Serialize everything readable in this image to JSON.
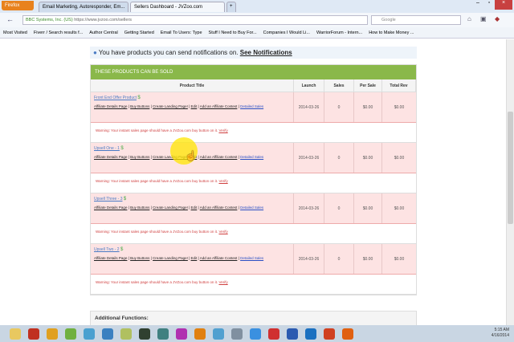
{
  "browser": {
    "menu": "Firefox",
    "tabs": [
      "Email Marketing, Autoresponder, Em...",
      "Sellers Dashboard - JVZoo.com"
    ],
    "identity": "BBC Systems, Inc. (US)",
    "url": "https://www.jvzoo.com/sellers",
    "search_placeholder": "Google",
    "bookmarks": [
      "Most Visited",
      "Fiverr / Search results f...",
      "Author Central",
      "Getting Started",
      "Email To Users: Type",
      "Stuff I Need to Buy For...",
      "Companies I Would Li...",
      "WarriorForum - Intern...",
      "How to Make Money ..."
    ]
  },
  "notice": {
    "text": "You have products you can send notifications on.",
    "link": "See Notifications"
  },
  "table": {
    "title": "THESE PRODUCTS CAN BE SOLD",
    "columns": [
      "Product Title",
      "Launch",
      "Sales",
      "Per Sale",
      "Total Rev"
    ],
    "actions": [
      "Affiliate Details Page",
      "Buy Buttons",
      "Create Landing Page!",
      "Edit",
      "Add an Affiliate Contest",
      "Detailed Sales"
    ],
    "warning": "Warning: Your instant sales page should have a JVZoo.com buy button on it.",
    "verify": "Verify",
    "rows": [
      {
        "title": "Front End Offer Product",
        "launch": "2014-03-26",
        "sales": "0",
        "per_sale": "$0.00",
        "total": "$0.00"
      },
      {
        "title": "Upsell One - 1",
        "launch": "2014-03-26",
        "sales": "0",
        "per_sale": "$0.00",
        "total": "$0.00"
      },
      {
        "title": "Upsell Three - 3",
        "launch": "2014-03-26",
        "sales": "0",
        "per_sale": "$0.00",
        "total": "$0.00"
      },
      {
        "title": "Upsell Two - 2",
        "launch": "2014-03-26",
        "sales": "0",
        "per_sale": "$0.00",
        "total": "$0.00"
      }
    ]
  },
  "additional": "Additional Functions:",
  "clock": {
    "time": "5:15 AM",
    "date": "4/16/2014"
  },
  "taskbar_icons": [
    [
      "explorer",
      "#e8c860"
    ],
    [
      "filezilla",
      "#c03020"
    ],
    [
      "chrome",
      "#e0a020"
    ],
    [
      "dragon",
      "#70b040"
    ],
    [
      "app1",
      "#4aa0d0"
    ],
    [
      "app2",
      "#3a80c0"
    ],
    [
      "notes",
      "#b0c060"
    ],
    [
      "app3",
      "#304030"
    ],
    [
      "app4",
      "#408080"
    ],
    [
      "picasa",
      "#b030b0"
    ],
    [
      "audacity",
      "#e08010"
    ],
    [
      "lync",
      "#50a0d0"
    ],
    [
      "app5",
      "#8090a0"
    ],
    [
      "ie",
      "#3a90e0"
    ],
    [
      "acrobat",
      "#d03030"
    ],
    [
      "word",
      "#2a5ab0"
    ],
    [
      "outlook",
      "#1a70c0"
    ],
    [
      "powerpoint",
      "#d04020"
    ],
    [
      "firefox",
      "#e06010"
    ]
  ]
}
